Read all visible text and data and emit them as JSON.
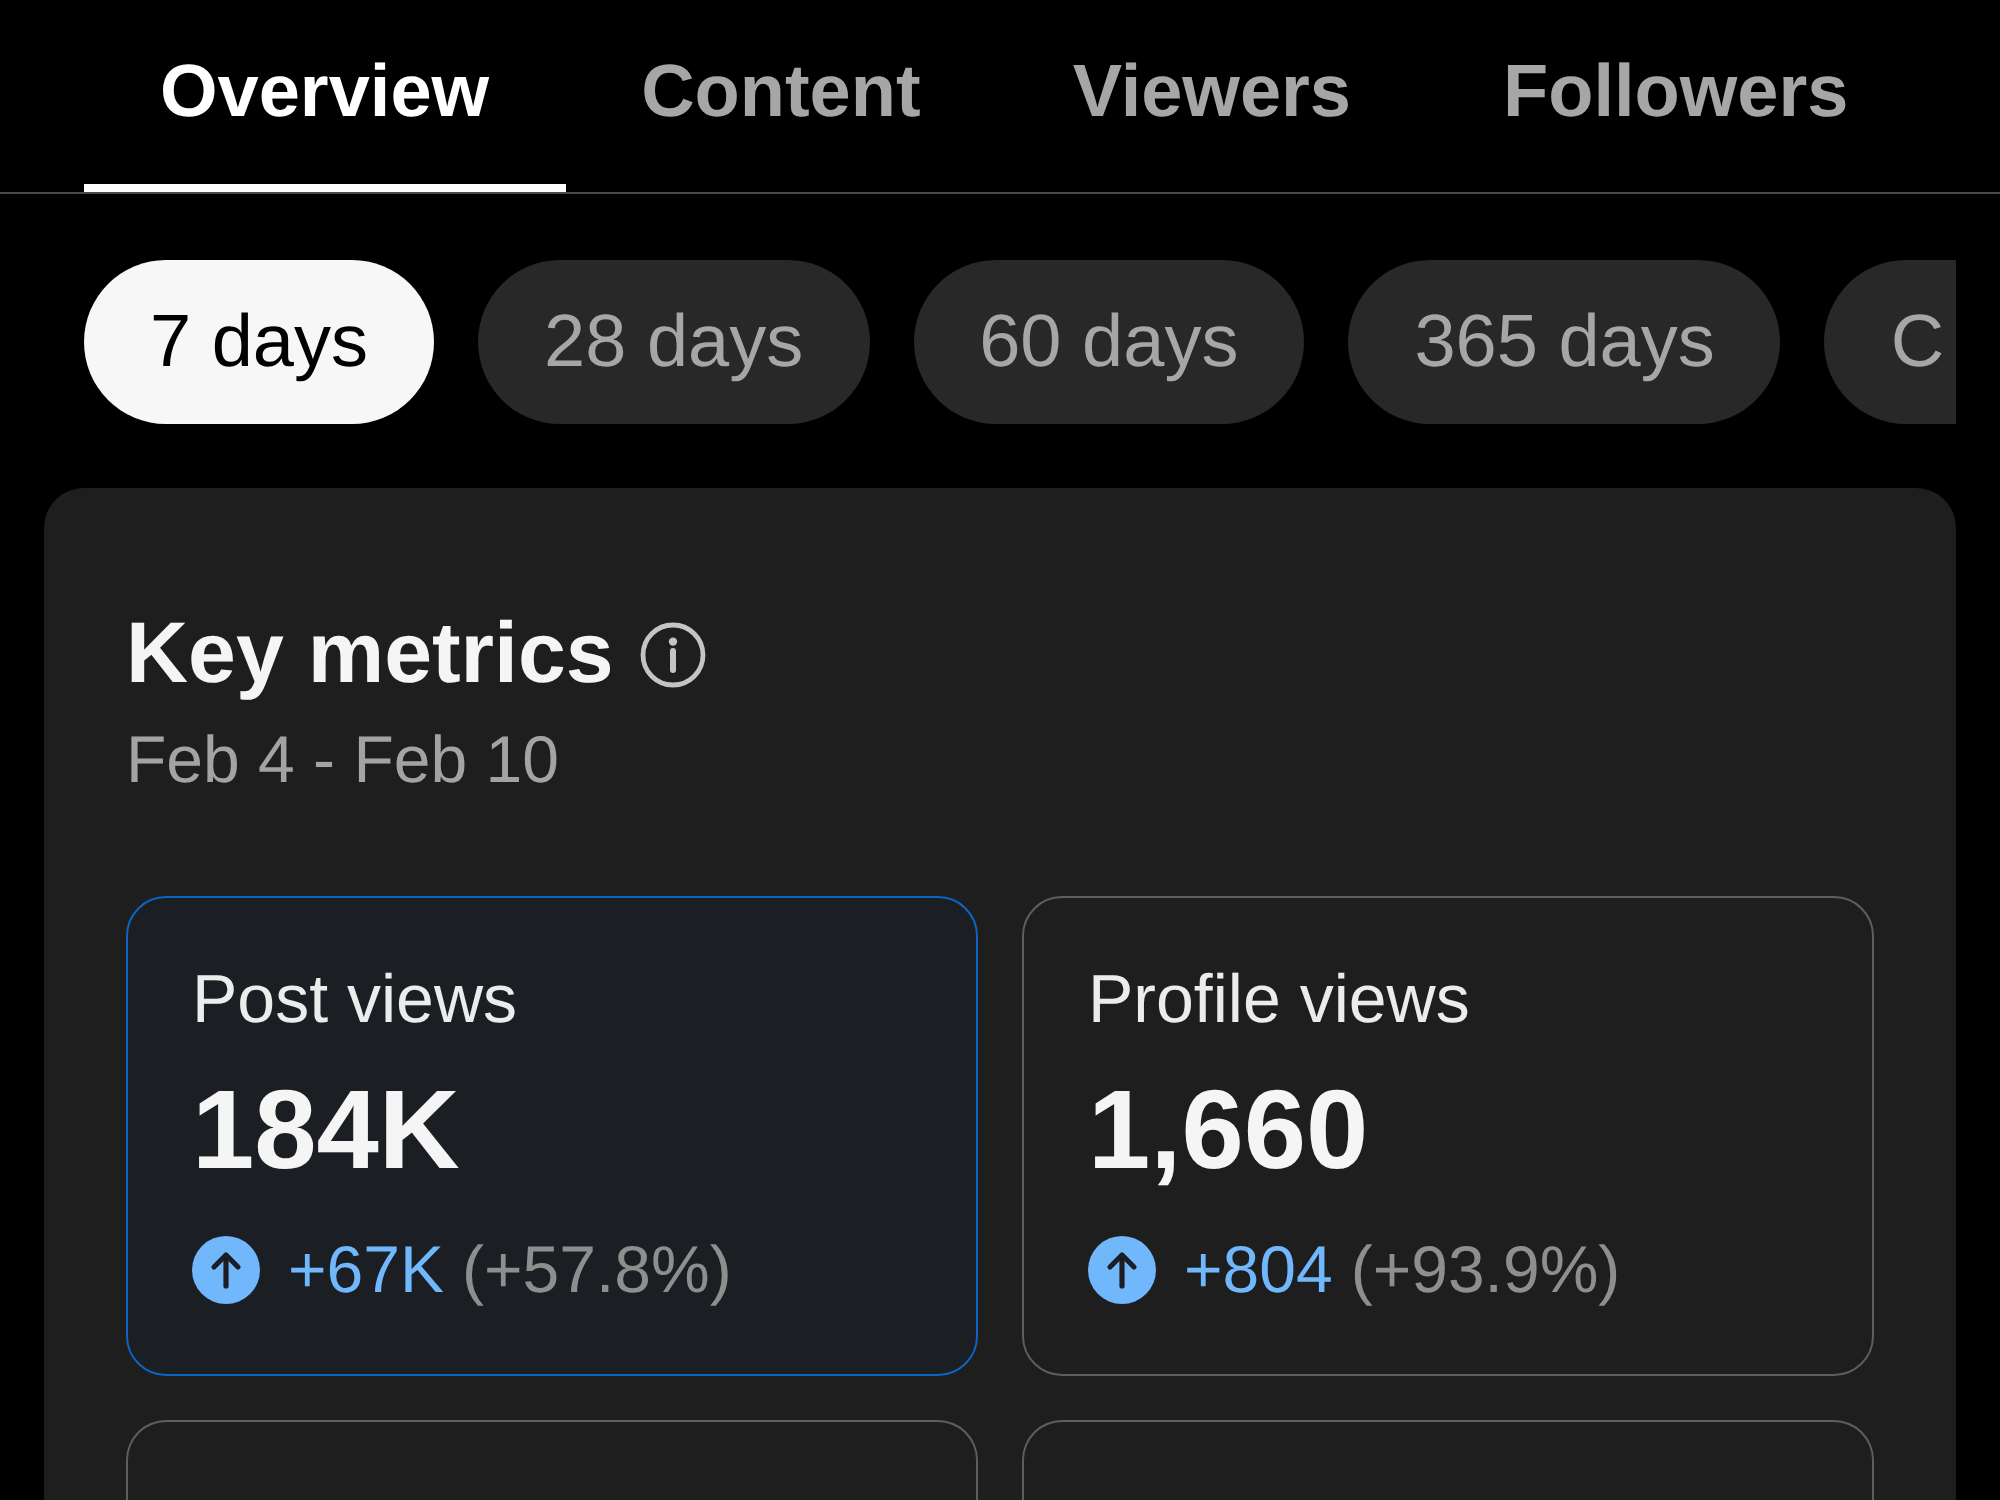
{
  "tabs": [
    {
      "label": "Overview",
      "selected": true
    },
    {
      "label": "Content",
      "selected": false
    },
    {
      "label": "Viewers",
      "selected": false
    },
    {
      "label": "Followers",
      "selected": false
    }
  ],
  "periods": [
    {
      "label": "7 days",
      "selected": true
    },
    {
      "label": "28 days",
      "selected": false
    },
    {
      "label": "60 days",
      "selected": false
    },
    {
      "label": "365 days",
      "selected": false
    },
    {
      "label": "C",
      "selected": false
    }
  ],
  "key_metrics": {
    "title": "Key metrics",
    "date_range": "Feb 4 - Feb 10",
    "metrics": [
      {
        "label": "Post views",
        "value": "184K",
        "change": {
          "up": true,
          "amount": "+67K",
          "percent": "(+57.8%)"
        },
        "selected": true
      },
      {
        "label": "Profile views",
        "value": "1,660",
        "change": {
          "up": true,
          "amount": "+804",
          "percent": "(+93.9%)"
        },
        "selected": false
      },
      {
        "selected": false
      },
      {
        "selected": false
      }
    ]
  }
}
